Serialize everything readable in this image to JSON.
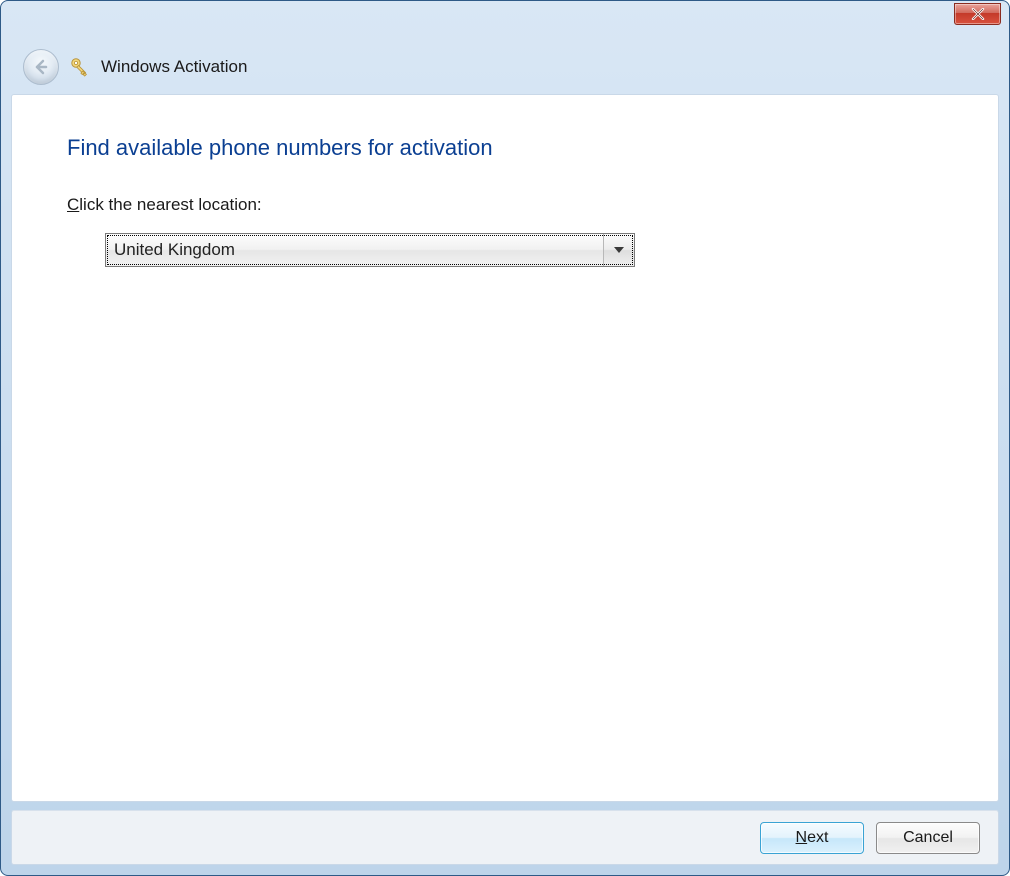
{
  "header": {
    "title": "Windows Activation"
  },
  "page": {
    "heading": "Find available phone numbers for activation",
    "instruction_underlined": "C",
    "instruction_rest": "lick the nearest location:"
  },
  "location_select": {
    "selected": "United Kingdom"
  },
  "footer": {
    "next_underlined": "N",
    "next_rest": "ext",
    "cancel_label": "Cancel"
  }
}
